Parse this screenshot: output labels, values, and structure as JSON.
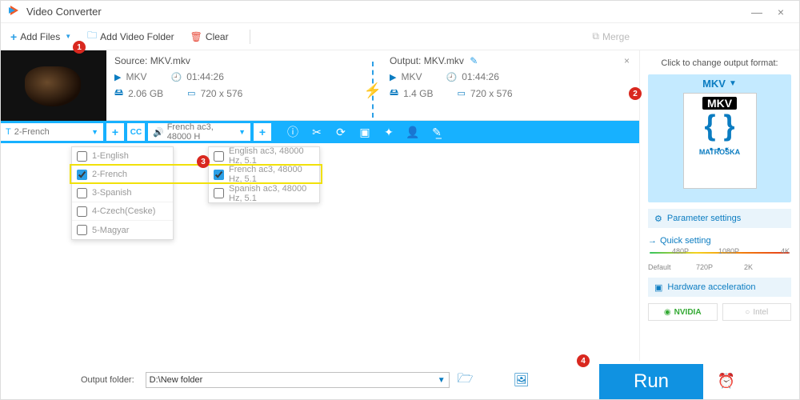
{
  "title": "Video Converter",
  "toolbar": {
    "add_files": "Add Files",
    "add_folder": "Add Video Folder",
    "clear": "Clear",
    "merge": "Merge"
  },
  "file": {
    "close": "×",
    "source": {
      "title": "Source: MKV.mkv",
      "container": "MKV",
      "duration": "01:44:26",
      "size": "2.06 GB",
      "resolution": "720 x 576"
    },
    "output": {
      "title": "Output: MKV.mkv",
      "container": "MKV",
      "duration": "01:44:26",
      "size": "1.4 GB",
      "resolution": "720 x 576"
    }
  },
  "bluebar": {
    "subtitle_selected": "2-French",
    "audio_selected": "French ac3, 48000 H"
  },
  "subtitles": {
    "0": {
      "label": "1-English",
      "checked": false
    },
    "1": {
      "label": "2-French",
      "checked": true
    },
    "2": {
      "label": "3-Spanish",
      "checked": false
    },
    "3": {
      "label": "4-Czech(Ceske)",
      "checked": false
    },
    "4": {
      "label": "5-Magyar",
      "checked": false
    }
  },
  "audios": {
    "0": {
      "label": "English ac3, 48000 Hz, 5.1",
      "checked": false
    },
    "1": {
      "label": "French ac3, 48000 Hz, 5.1",
      "checked": true
    },
    "2": {
      "label": "Spanish ac3, 48000 Hz, 5.1",
      "checked": false
    }
  },
  "right": {
    "click_title": "Click to change output format:",
    "format_label": "MKV",
    "mkv_txt": "MKV",
    "matroska": "MATROŠKA",
    "param_settings": "Parameter settings",
    "quick_setting": "Quick setting",
    "scale": {
      "p480": "480P",
      "p720": "720P",
      "p1080": "1080P",
      "p2k": "2K",
      "p4k": "4K",
      "def": "Default"
    },
    "hw_accel": "Hardware acceleration",
    "nvidia": "NVIDIA",
    "intel": "Intel"
  },
  "bottom": {
    "label": "Output folder:",
    "path": "D:\\New folder",
    "run": "Run"
  },
  "badges": {
    "b1": "1",
    "b2": "2",
    "b3": "3",
    "b4": "4"
  }
}
